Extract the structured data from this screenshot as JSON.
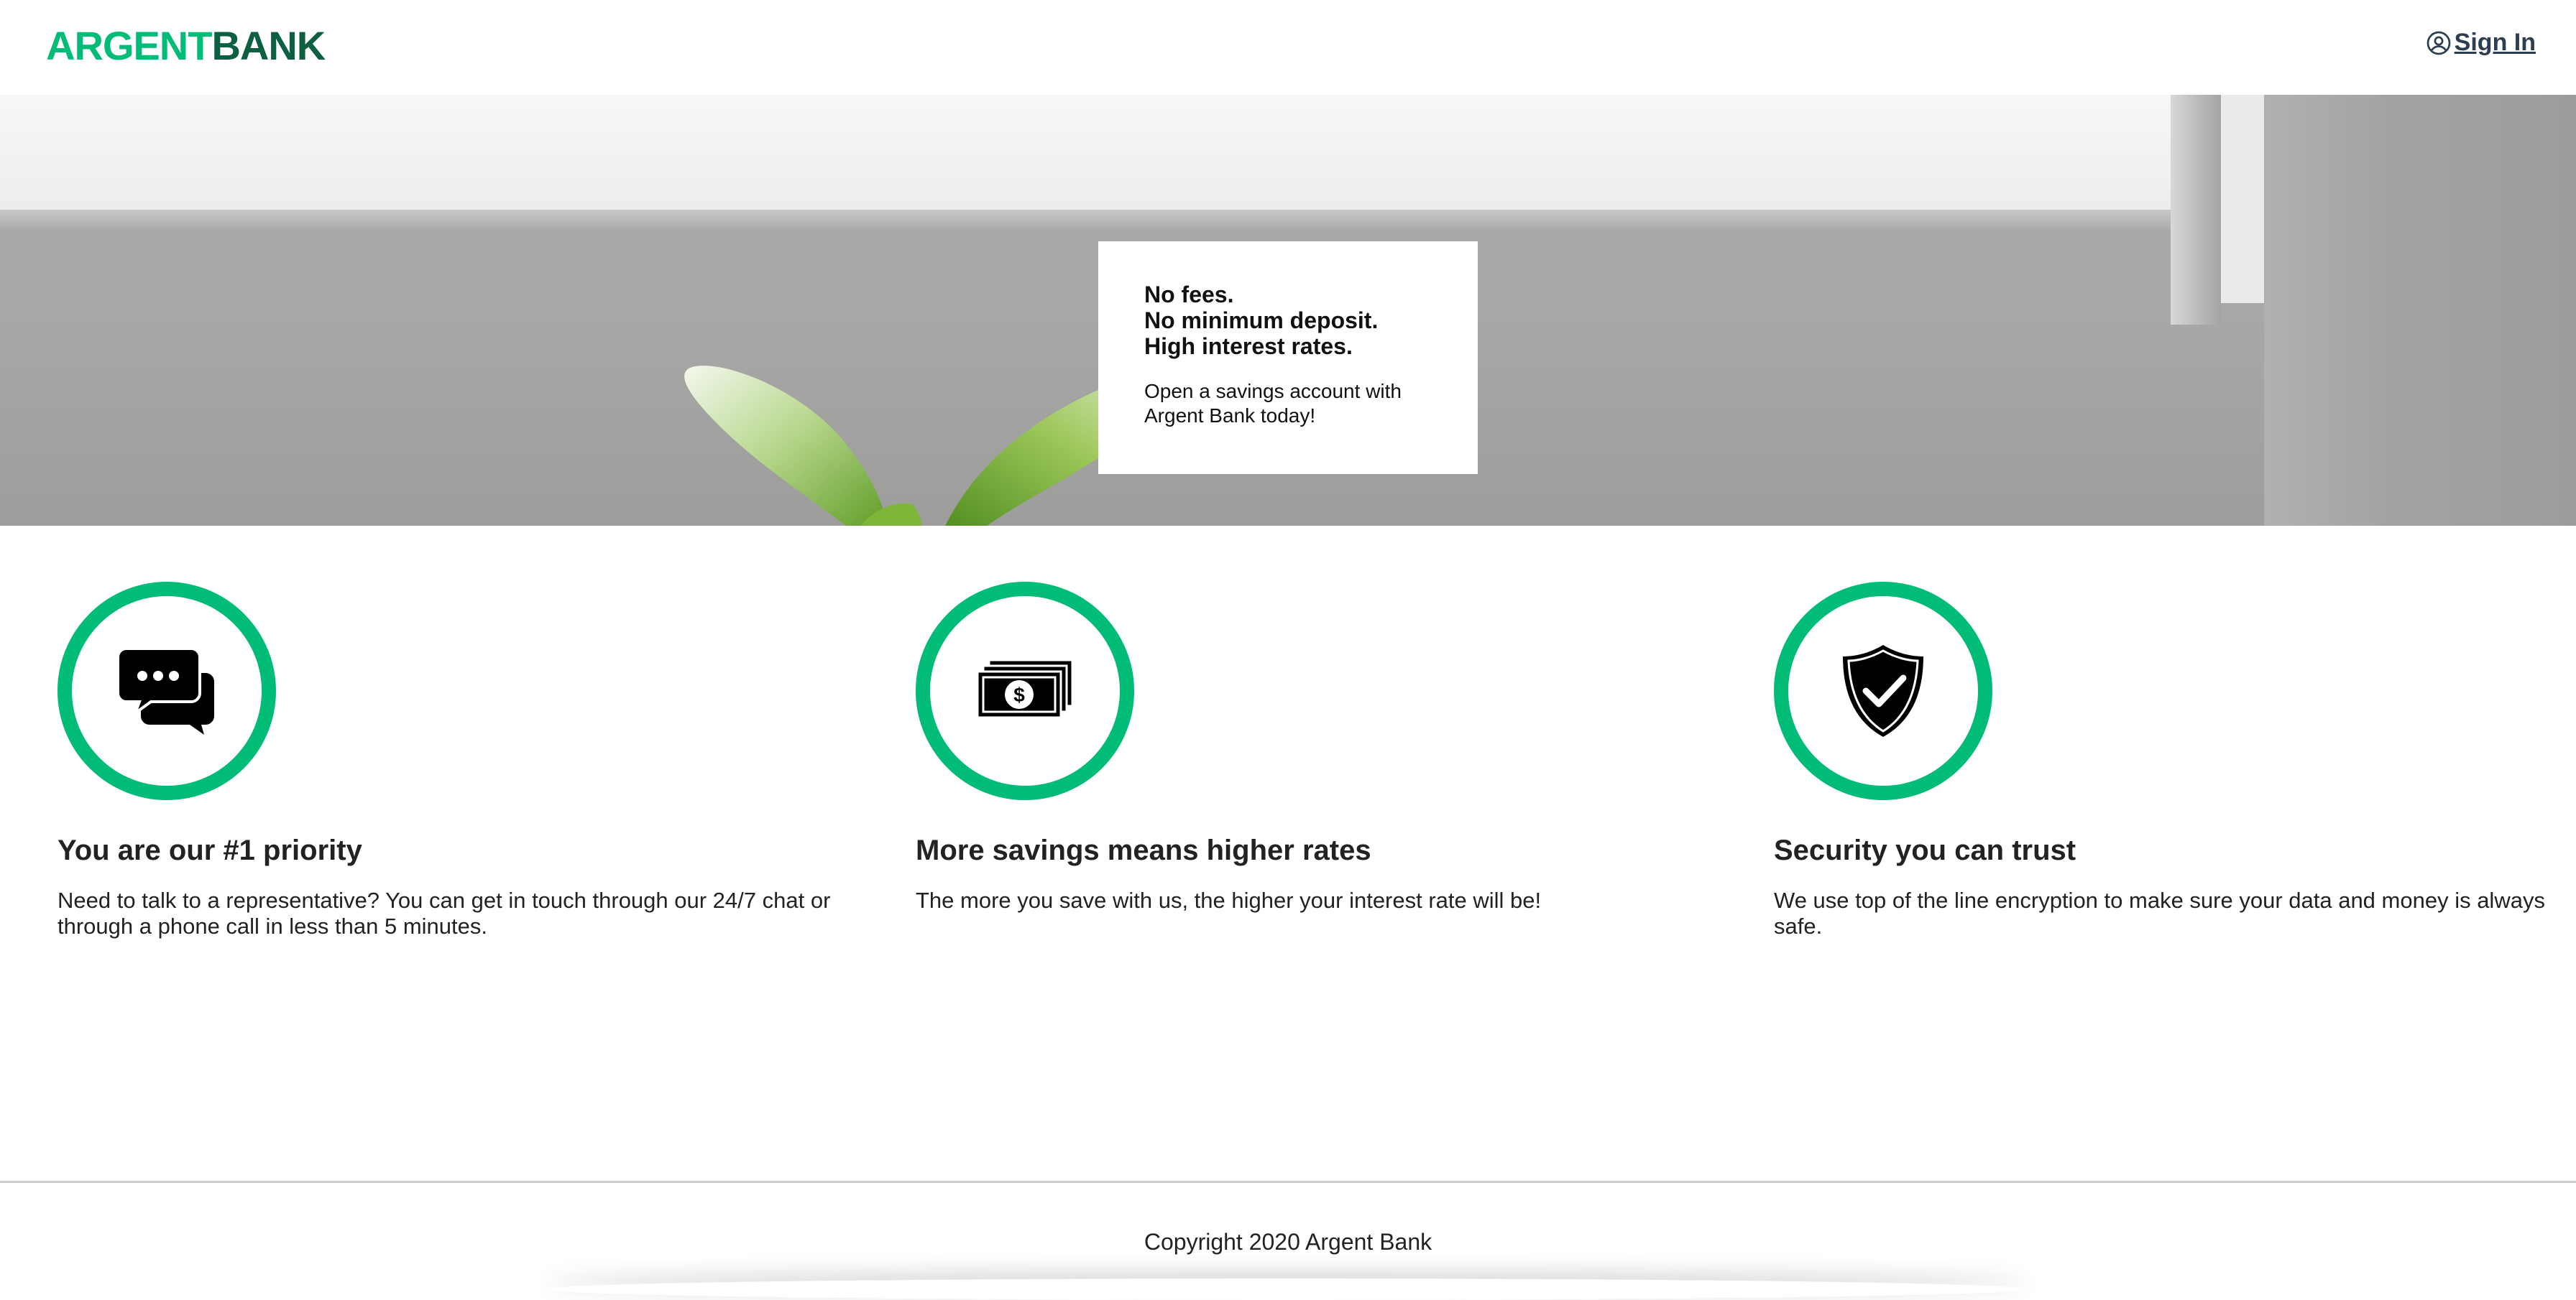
{
  "header": {
    "logo_part1": "ARGENT",
    "logo_part2": "BANK",
    "sign_in_label": "Sign In"
  },
  "hero": {
    "subtitles": [
      "No fees.",
      "No minimum deposit.",
      "High interest rates."
    ],
    "text": "Open a savings account with Argent Bank today!"
  },
  "features": [
    {
      "icon": "chat-icon",
      "title": "You are our #1 priority",
      "text": "Need to talk to a representative? You can get in touch through our 24/7 chat or through a phone call in less than 5 minutes."
    },
    {
      "icon": "money-icon",
      "title": "More savings means higher rates",
      "text": "The more you save with us, the higher your interest rate will be!"
    },
    {
      "icon": "shield-icon",
      "title": "Security you can trust",
      "text": "We use top of the line encryption to make sure your data and money is always safe."
    }
  ],
  "footer": {
    "copyright": "Copyright 2020 Argent Bank"
  },
  "colors": {
    "brand_green": "#00bc77",
    "brand_dark_green": "#0c5f3f",
    "text_dark": "#2c3e50"
  }
}
